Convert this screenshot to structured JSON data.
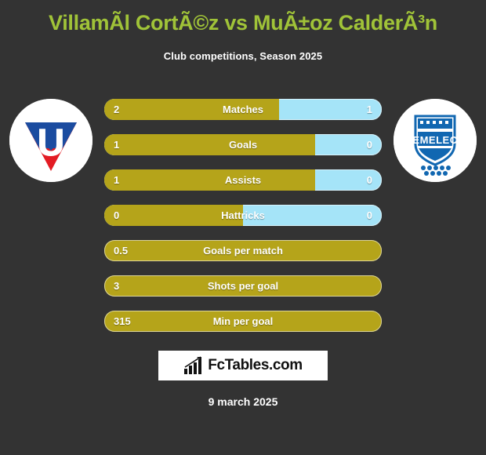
{
  "header": {
    "title": "VillamÃ­l CortÃ©z vs MuÃ±oz CalderÃ³n",
    "subtitle": "Club competitions, Season 2025"
  },
  "colors": {
    "background": "#333333",
    "title": "#a0c338",
    "home_bar": "#b5a41a",
    "away_bar": "#a5e4f8",
    "text": "#ffffff"
  },
  "teams": {
    "home": {
      "crest_name": "ldu-quito-crest",
      "crest_letter": "U"
    },
    "away": {
      "crest_name": "emelec-crest",
      "crest_text": "EMELEC"
    }
  },
  "stats": [
    {
      "label": "Matches",
      "home": "2",
      "away": "1",
      "home_pct": 63,
      "dual": true
    },
    {
      "label": "Goals",
      "home": "1",
      "away": "0",
      "home_pct": 76,
      "dual": true
    },
    {
      "label": "Assists",
      "home": "1",
      "away": "0",
      "home_pct": 76,
      "dual": true
    },
    {
      "label": "Hattricks",
      "home": "0",
      "away": "0",
      "home_pct": 50,
      "dual": true
    },
    {
      "label": "Goals per match",
      "home": "0.5",
      "away": "",
      "home_pct": 100,
      "dual": false
    },
    {
      "label": "Shots per goal",
      "home": "3",
      "away": "",
      "home_pct": 100,
      "dual": false
    },
    {
      "label": "Min per goal",
      "home": "315",
      "away": "",
      "home_pct": 100,
      "dual": false
    }
  ],
  "footer": {
    "logo_text": "FcTables.com",
    "logo_icon": "bar-chart-icon",
    "date": "9 march 2025"
  }
}
